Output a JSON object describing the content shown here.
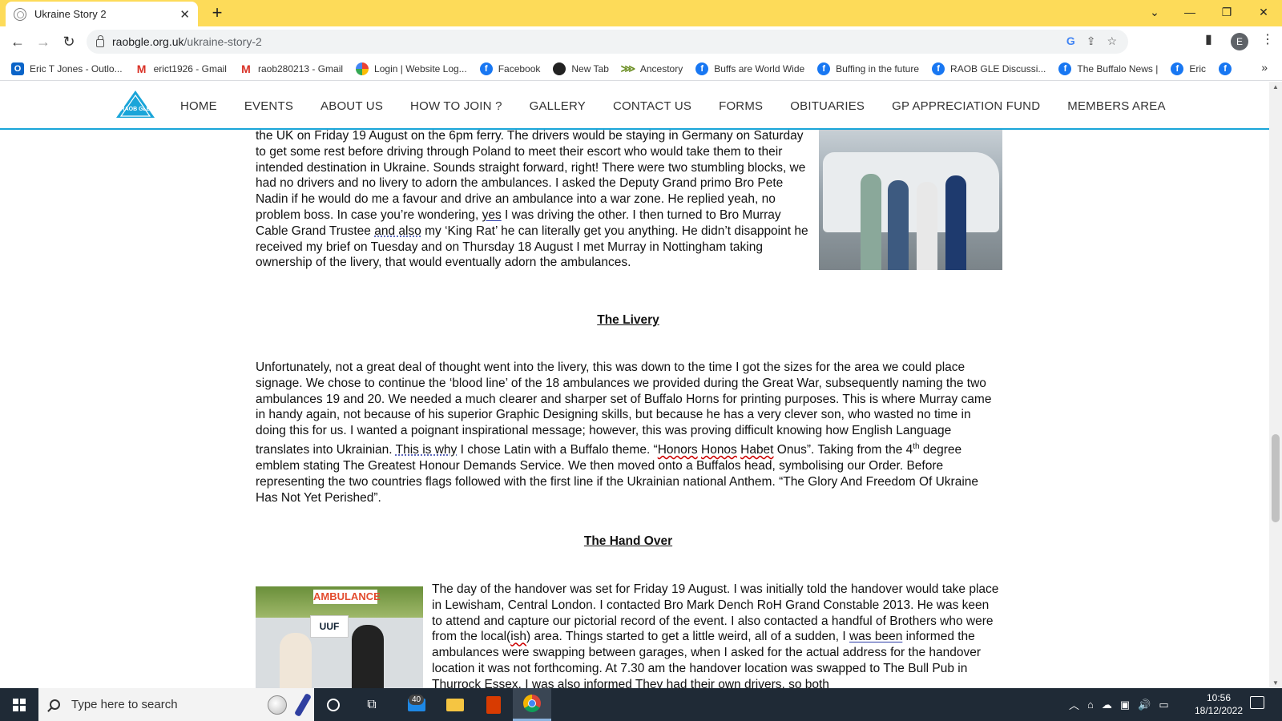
{
  "browser": {
    "tab_title": "Ukraine Story 2",
    "new_tab": "+",
    "url_host": "raobgle.org.uk",
    "url_path": "/ukraine-story-2",
    "profile_initial": "E"
  },
  "bookmarks": [
    {
      "label": "Eric T Jones - Outlo...",
      "icon": "outlook-icon"
    },
    {
      "label": "erict1926 - Gmail",
      "icon": "gmail-icon"
    },
    {
      "label": "raob280213 - Gmail",
      "icon": "gmail-icon"
    },
    {
      "label": "Login | Website Log...",
      "icon": "login-icon"
    },
    {
      "label": "Facebook",
      "icon": "facebook-icon"
    },
    {
      "label": "New Tab",
      "icon": "newtab-icon"
    },
    {
      "label": "Ancestory",
      "icon": "ancestry-icon"
    },
    {
      "label": "Buffs are World Wide",
      "icon": "facebook-icon"
    },
    {
      "label": "Buffing in the future",
      "icon": "facebook-icon"
    },
    {
      "label": "RAOB GLE Discussi...",
      "icon": "facebook-icon"
    },
    {
      "label": "The Buffalo News |",
      "icon": "facebook-icon"
    },
    {
      "label": "Eric",
      "icon": "facebook-icon"
    }
  ],
  "site": {
    "logo_text": "RAOB GLE",
    "menu": [
      "HOME",
      "EVENTS",
      "ABOUT US",
      "HOW TO JOIN ?",
      "GALLERY",
      "CONTACT US",
      "FORMS",
      "OBITUARIES",
      "GP APPRECIATION FUND",
      "MEMBERS AREA"
    ]
  },
  "article": {
    "para1": {
      "t1": "the UK on Friday 19 August on the 6pm ferry. The drivers would be staying in Germany on Saturday to get some rest before driving through Poland to meet their escort who would take them to their intended destination in Ukraine. Sounds straight forward, right! There were two stumbling blocks, we had no drivers and no livery to adorn the ambulances. I asked the Deputy Grand primo Bro Pete Nadin if he would do me a favour and drive an ambulance into a war zone. He replied yeah, no problem boss. In case you’re wondering, ",
      "yes": "yes",
      "t2": " I was driving the other. I then turned to Bro Murray Cable Grand Trustee ",
      "and_also": "and also",
      "t3": " my ‘King Rat’ he can literally get you anything. He didn’t disappoint he received my brief on Tuesday and on Thursday 18 August I met Murray in Nottingham taking ownership of the livery, that would eventually adorn the ambulances."
    },
    "heading_livery": "The Livery",
    "para2": {
      "t1": "Unfortunately, not a great deal of thought went into the livery, this was down to the time I got the sizes for the area we could place signage. We chose to continue the ‘blood line’ of the 18 ambulances we provided during the Great War, subsequently naming the two ambulances 19 and 20. We needed a much clearer and sharper set of Buffalo Horns for printing purposes. This is where Murray came in handy again, not because of his superior Graphic Designing skills, but because he has a very clever son, who wasted no time in doing this for us. I wanted a poignant inspirational message; however, this was proving difficult knowing how English Language translates into Ukrainian. ",
      "this_is_why": "This is why",
      "t2": " I chose Latin with a Buffalo theme. “",
      "honors": "Honors",
      "sp1": " ",
      "honos": "Honos",
      "sp2": " ",
      "habet": "Habet",
      "t3": " Onus”. Taking from the 4",
      "sup": "th",
      "t4": " degree emblem stating The Greatest Honour Demands Service. We then moved onto a Buffalos head, symbolising our Order. Before representing the two countries flags followed with the first line if the Ukrainian national Anthem. “The Glory And Freedom Of Ukraine Has Not Yet Perished”."
    },
    "heading_handover": "The Hand Over",
    "para3": {
      "t1": "The day of the handover was set for Friday 19 August. I was initially told the handover would take place in Lewisham, Central London. I contacted Bro Mark Dench RoH Grand Constable 2013. He was keen to attend and capture our pictorial record of the event. I also contacted a handful of Brothers who were from the local(",
      "ish": "ish",
      "t2": ") area. Things started to get a little weird, all of a sudden, I ",
      "was_been": "was been",
      "t3": " informed the ambulances were swapping between garages, when I asked for the actual address for the handover location it was not forthcoming. At 7.30 am the handover location was swapped to The Bull Pub in Thurrock Essex. I was also informed They had their own drivers, so both"
    },
    "photo2_banner": "AMBULANCE",
    "photo2_logo": "UUF"
  },
  "taskbar": {
    "search_placeholder": "Type here to search",
    "mail_badge": "40",
    "time": "10:56",
    "date": "18/12/2022"
  }
}
